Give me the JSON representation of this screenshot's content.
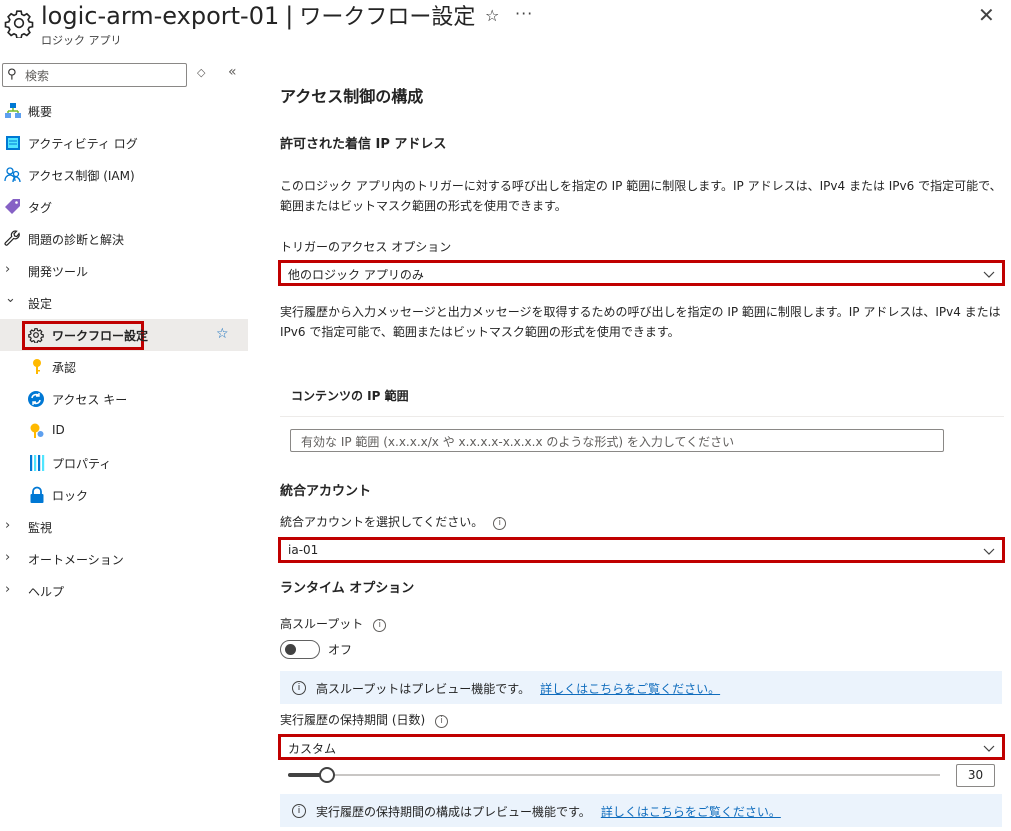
{
  "header": {
    "resource_name": "logic-arm-export-01",
    "separator": "|",
    "page_name": "ワークフロー設定",
    "resource_type": "ロジック アプリ",
    "star_glyph": "☆",
    "more_glyph": "···",
    "close_glyph": "✕"
  },
  "sidebar": {
    "search_placeholder": "検索",
    "search_icon": "⚲",
    "updown_glyph": "◇",
    "collapse_glyph": "«",
    "items": [
      {
        "label": "概要",
        "icon": "overview-icon"
      },
      {
        "label": "アクティビティ ログ",
        "icon": "activity-log-icon"
      },
      {
        "label": "アクセス制御 (IAM)",
        "icon": "iam-icon"
      },
      {
        "label": "タグ",
        "icon": "tag-icon"
      },
      {
        "label": "問題の診断と解決",
        "icon": "wrench-icon"
      },
      {
        "label": "開発ツール",
        "expand": "›"
      },
      {
        "label": "設定",
        "expand": "⌄"
      },
      {
        "label": "ワークフロー設定",
        "icon": "gear-icon",
        "selected": true,
        "pin": "☆"
      },
      {
        "label": "承認",
        "icon": "key-icon"
      },
      {
        "label": "アクセス キー",
        "icon": "access-key-icon"
      },
      {
        "label": "ID",
        "icon": "identity-icon"
      },
      {
        "label": "プロパティ",
        "icon": "properties-icon"
      },
      {
        "label": "ロック",
        "icon": "lock-icon"
      },
      {
        "label": "監視",
        "expand": "›"
      },
      {
        "label": "オートメーション",
        "expand": "›"
      },
      {
        "label": "ヘルプ",
        "expand": "›"
      }
    ]
  },
  "main": {
    "section_title": "アクセス制御の構成",
    "incoming_ip_heading": "許可された着信 IP アドレス",
    "incoming_ip_desc": "このロジック アプリ内のトリガーに対する呼び出しを指定の IP 範囲に制限します。IP アドレスは、IPv4 または IPv6 で指定可能で、範囲またはビットマスク範囲の形式を使用できます。",
    "trigger_access_label": "トリガーのアクセス オプション",
    "trigger_access_value": "他のロジック アプリのみ",
    "history_desc": "実行履歴から入力メッセージと出力メッセージを取得するための呼び出しを指定の IP 範囲に制限します。IP アドレスは、IPv4 または IPv6 で指定可能で、範囲またはビットマスク範囲の形式を使用できます。",
    "content_ip_heading": "コンテンツの IP 範囲",
    "content_ip_placeholder": "有効な IP 範囲 (x.x.x.x/x や x.x.x.x-x.x.x.x のような形式) を入力してください",
    "integration_heading": "統合アカウント",
    "integration_label": "統合アカウントを選択してください。",
    "integration_value": "ia-01",
    "runtime_heading": "ランタイム オプション",
    "throughput_label": "高スループット",
    "throughput_state": "オフ",
    "throughput_info": "高スループットはプレビュー機能です。",
    "throughput_link": "詳しくはこちらをご覧ください。",
    "retention_label": "実行履歴の保持期間 (日数)",
    "retention_value": "カスタム",
    "retention_days": "30",
    "retention_fraction": 0.06,
    "retention_info": "実行履歴の保持期間の構成はプレビュー機能です。",
    "retention_link": "詳しくはこちらをご覧ください。",
    "info_glyph": "i"
  },
  "colors": {
    "highlight": "#c00000",
    "link": "#0f6cbd",
    "info_bg": "#ebf3fc",
    "selected_bg": "#edebe9"
  }
}
